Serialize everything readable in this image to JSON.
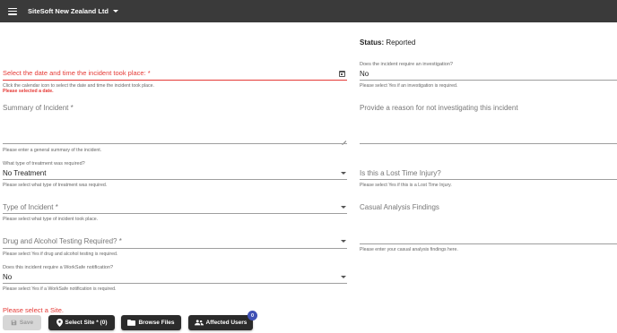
{
  "header": {
    "org_name": "SiteSoft New Zealand Ltd"
  },
  "status": {
    "label": "Status:",
    "value": "Reported"
  },
  "left": {
    "incident_date": {
      "label": "Select the date and time the incident took place: *",
      "helper": "Click the calendar icon to select the date and time the incident took place.",
      "error": "Please selected a date."
    },
    "summary": {
      "label": "Summary of Incident *",
      "helper": "Please enter a general summary of the incident."
    },
    "treatment": {
      "label": "What type of treatment was required?",
      "value": "No Treatment",
      "helper": "Please select what type of treatment was required."
    },
    "incident_type": {
      "label": "Type of Incident *",
      "helper": "Please select what type of incident took place."
    },
    "drug_testing": {
      "label": "Drug and Alcohol Testing Required? *",
      "helper": "Please select Yes if drug and alcohol testing is required."
    },
    "worksafe": {
      "label": "Does this incident require a WorkSafe notification?",
      "value": "No",
      "helper": "Please select Yes if a WorkSafe notification is required."
    },
    "site_error": "Please select a Site."
  },
  "right": {
    "investigation": {
      "label": "Does the incident require an investigation?",
      "value": "No",
      "helper": "Please select Yes if an investigation is required."
    },
    "no_investigation_reason": {
      "label": "Provide a reason for not investigating this incident"
    },
    "lost_time": {
      "label": "Is this a Lost Time Injury?",
      "helper": "Please select Yes if this is a Lost Time Injury."
    },
    "casual_analysis": {
      "label": "Casual Analysis Findings",
      "helper": "Please enter your casual analysis findings here."
    }
  },
  "actions": {
    "save": "Save",
    "select_site": "Select Site * (0)",
    "browse_files": "Browse Files",
    "affected_users": "Affected Users",
    "affected_users_count": "0"
  },
  "colors": {
    "topbar": "#3a3a3a",
    "error": "#e53935",
    "button": "#2b2b2b",
    "badge": "#3f51b5"
  }
}
